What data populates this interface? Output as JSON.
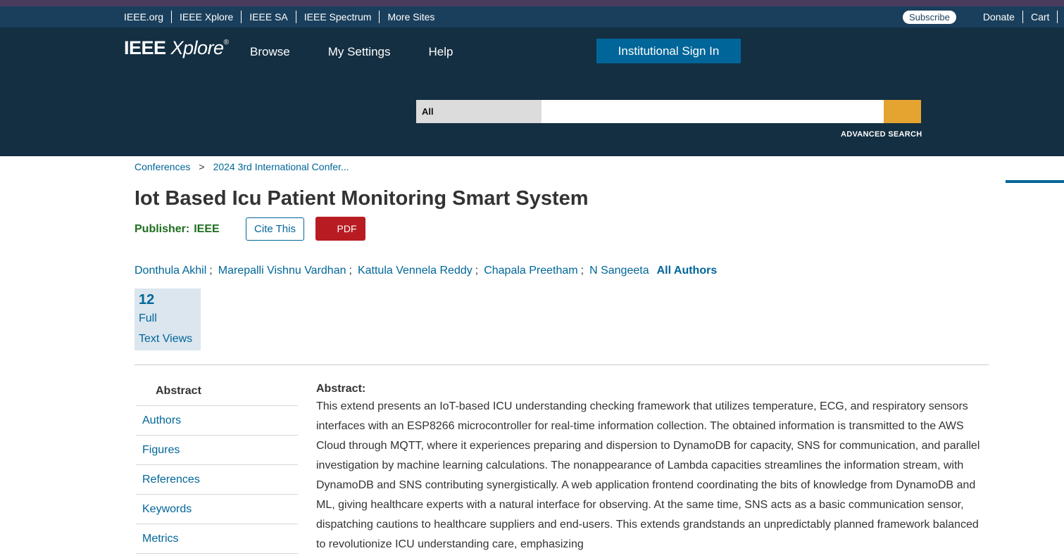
{
  "topbar": {
    "links": [
      "IEEE.org",
      "IEEE Xplore",
      "IEEE SA",
      "IEEE Spectrum",
      "More Sites"
    ],
    "subscribe": "Subscribe",
    "donate": "Donate",
    "cart": "Cart"
  },
  "header": {
    "logo_main": "IEEE ",
    "logo_italic": "Xplore",
    "logo_mark": "®",
    "nav": [
      "Browse",
      "My Settings",
      "Help"
    ],
    "signin": "Institutional Sign In"
  },
  "search": {
    "scope": "All",
    "query": "",
    "advanced": "ADVANCED SEARCH"
  },
  "breadcrumb": {
    "items": [
      "Conferences",
      "2024 3rd International Confer..."
    ],
    "separator": ">"
  },
  "article": {
    "title": "Iot Based Icu Patient Monitoring Smart System",
    "publisher_label": "Publisher:",
    "publisher_name": "IEEE",
    "cite_label": "Cite This",
    "pdf_label": "PDF",
    "authors": [
      "Donthula Akhil",
      "Marepalli Vishnu Vardhan",
      "Kattula Vennela Reddy",
      "Chapala Preetham",
      "N Sangeeta"
    ],
    "all_authors": "All Authors",
    "metric": {
      "count": "12",
      "label_line1": "Full",
      "label_line2": "Text Views"
    }
  },
  "sidenav": {
    "items": [
      "Abstract",
      "Authors",
      "Figures",
      "References",
      "Keywords",
      "Metrics"
    ],
    "active": "Abstract"
  },
  "abstract": {
    "heading": "Abstract:",
    "text": "This extend presents an IoT-based ICU understanding checking framework that utilizes temperature, ECG, and respiratory sensors interfaces with an ESP8266 microcontroller for real-time information collection. The obtained information is transmitted to the AWS Cloud through MQTT, where it experiences preparing and dispersion to DynamoDB for capacity, SNS for communication, and parallel investigation by machine learning calculations. The nonappearance of Lambda capacities streamlines the information stream, with DynamoDB and SNS contributing synergistically. A web application frontend coordinating the bits of knowledge from DynamoDB and ML, giving healthcare experts with a natural interface for observing. At the same time, SNS acts as a basic communication sensor, dispatching cautions to healthcare suppliers and end-users. This extends grandstands an unpredictably planned framework balanced to revolutionize ICU understanding care, emphasizing"
  },
  "colors": {
    "topbar": "#1a3f5c",
    "header": "#142f42",
    "link": "#006699",
    "search_button": "#e5a42f",
    "pdf_button": "#b81c22",
    "publisher": "#1e6e1e"
  }
}
